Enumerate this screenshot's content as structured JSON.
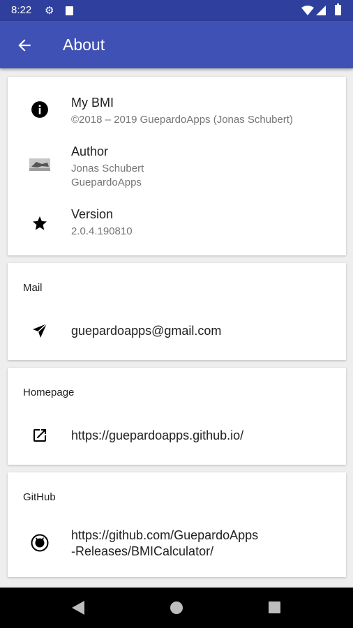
{
  "status_bar": {
    "time": "8:22",
    "icons": [
      "gear-icon",
      "sd-card-icon",
      "wifi-icon",
      "signal-icon",
      "battery-icon"
    ]
  },
  "app_bar": {
    "title": "About",
    "back_icon": "arrow-back-icon"
  },
  "info_card": {
    "app": {
      "icon": "info-icon",
      "title": "My BMI",
      "subtitle": "©2018 – 2019 GuepardoApps (Jonas Schubert)"
    },
    "author": {
      "icon": "author-photo",
      "title": "Author",
      "line1": "Jonas Schubert",
      "line2": "GuepardoApps"
    },
    "version": {
      "icon": "star-icon",
      "title": "Version",
      "value": "2.0.4.190810"
    }
  },
  "mail_card": {
    "header": "Mail",
    "icon": "send-icon",
    "value": "guepardoapps@gmail.com"
  },
  "homepage_card": {
    "header": "Homepage",
    "icon": "open-in-new-icon",
    "value": "https://guepardoapps.github.io/"
  },
  "github_card": {
    "header": "GitHub",
    "icon": "github-icon",
    "line1": "https://github.com/GuepardoApps",
    "line2": "-Releases/BMICalculator/"
  },
  "nav_bar": {
    "icons": [
      "nav-back-icon",
      "nav-home-icon",
      "nav-recents-icon"
    ]
  },
  "colors": {
    "primary": "#3f51b5",
    "primary_dark": "#2f3f9e",
    "background": "#eeeeee",
    "card": "#ffffff",
    "secondary_text": "#757575"
  }
}
